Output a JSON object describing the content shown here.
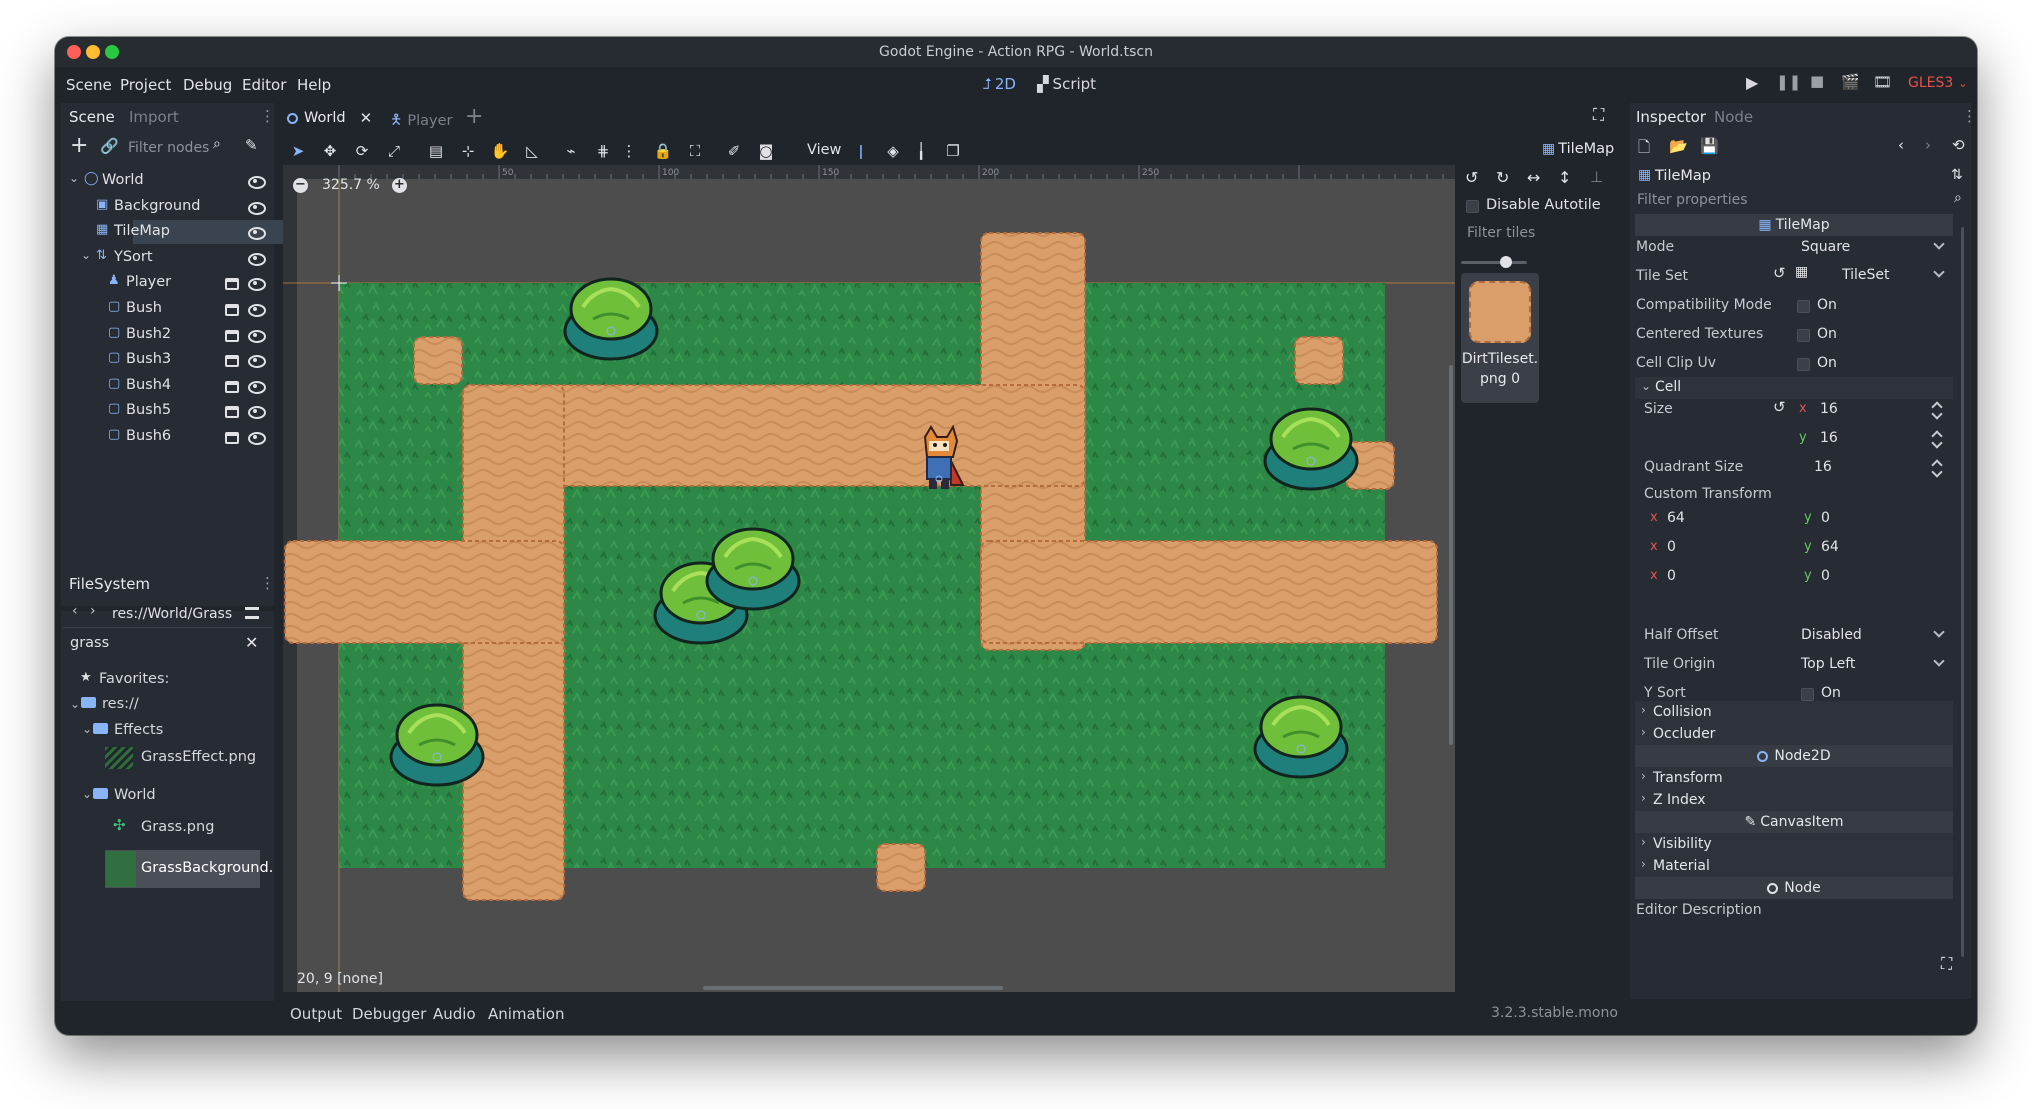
{
  "window": {
    "title": "Godot Engine - Action RPG - World.tscn"
  },
  "menu": {
    "items": [
      "Scene",
      "Project",
      "Debug",
      "Editor",
      "Help"
    ]
  },
  "workspace": {
    "mode_2d": "2D",
    "mode_script": "Script",
    "renderer": "GLES3"
  },
  "scene_dock": {
    "tab_scene": "Scene",
    "tab_import": "Import",
    "filter_placeholder": "Filter nodes",
    "nodes": [
      {
        "label": "World",
        "indent": 0
      },
      {
        "label": "Background",
        "indent": 1
      },
      {
        "label": "TileMap",
        "indent": 1,
        "selected": true
      },
      {
        "label": "YSort",
        "indent": 1
      },
      {
        "label": "Player",
        "indent": 2
      },
      {
        "label": "Bush",
        "indent": 2
      },
      {
        "label": "Bush2",
        "indent": 2
      },
      {
        "label": "Bush3",
        "indent": 2
      },
      {
        "label": "Bush4",
        "indent": 2
      },
      {
        "label": "Bush5",
        "indent": 2
      },
      {
        "label": "Bush6",
        "indent": 2
      }
    ]
  },
  "filesystem": {
    "title": "FileSystem",
    "path": "res://World/Grass",
    "search": "grass",
    "favorites": "Favorites:",
    "root": "res://",
    "folder_effects": "Effects",
    "file_grass_effect": "GrassEffect.png",
    "folder_world": "World",
    "file_grass": "Grass.png",
    "file_grass_bg": "GrassBackground."
  },
  "editor_tabs": {
    "world": "World",
    "player": "Player"
  },
  "viewport": {
    "zoom": "325.7 %",
    "view_menu": "View",
    "status": "20, 9 [none]",
    "ruler_labels": [
      "50",
      "100",
      "150",
      "200",
      "250"
    ],
    "tilemap_badge": "TileMap"
  },
  "tile_palette": {
    "disable_autotile": "Disable Autotile",
    "filter_placeholder": "Filter tiles",
    "tile_name": "DirtTileset.\npng 0"
  },
  "inspector": {
    "tab_inspector": "Inspector",
    "tab_node": "Node",
    "node_name": "TileMap",
    "filter_placeholder": "Filter properties",
    "section_tilemap": "TileMap",
    "mode_label": "Mode",
    "mode_value": "Square",
    "tileset_label": "Tile Set",
    "tileset_value": "TileSet",
    "compat_label": "Compatibility Mode",
    "centered_label": "Centered Textures",
    "clipuv_label": "Cell Clip Uv",
    "on": "On",
    "cell_group": "Cell",
    "size_label": "Size",
    "size_x": "16",
    "size_y": "16",
    "quadrant_label": "Quadrant Size",
    "quadrant_value": "16",
    "custom_transform_label": "Custom Transform",
    "transform_rows": [
      [
        "64",
        "0"
      ],
      [
        "0",
        "64"
      ],
      [
        "0",
        "0"
      ]
    ],
    "axis_x": "x",
    "axis_y": "y",
    "half_offset_label": "Half Offset",
    "half_offset_value": "Disabled",
    "tile_origin_label": "Tile Origin",
    "tile_origin_value": "Top Left",
    "ysort_label": "Y Sort",
    "collision": "Collision",
    "occluder": "Occluder",
    "section_node2d": "Node2D",
    "transform": "Transform",
    "zindex": "Z Index",
    "section_canvasitem": "CanvasItem",
    "visibility": "Visibility",
    "material": "Material",
    "section_node": "Node",
    "editor_description": "Editor Description"
  },
  "bottom_panel": {
    "tabs": [
      "Output",
      "Debugger",
      "Audio",
      "Animation"
    ],
    "version": "3.2.3.stable.mono"
  },
  "colors": {
    "accent": "#8ab4f8",
    "renderer": "#e5534b",
    "grass": "#2e8a48",
    "dirt": "#d9a06b"
  }
}
